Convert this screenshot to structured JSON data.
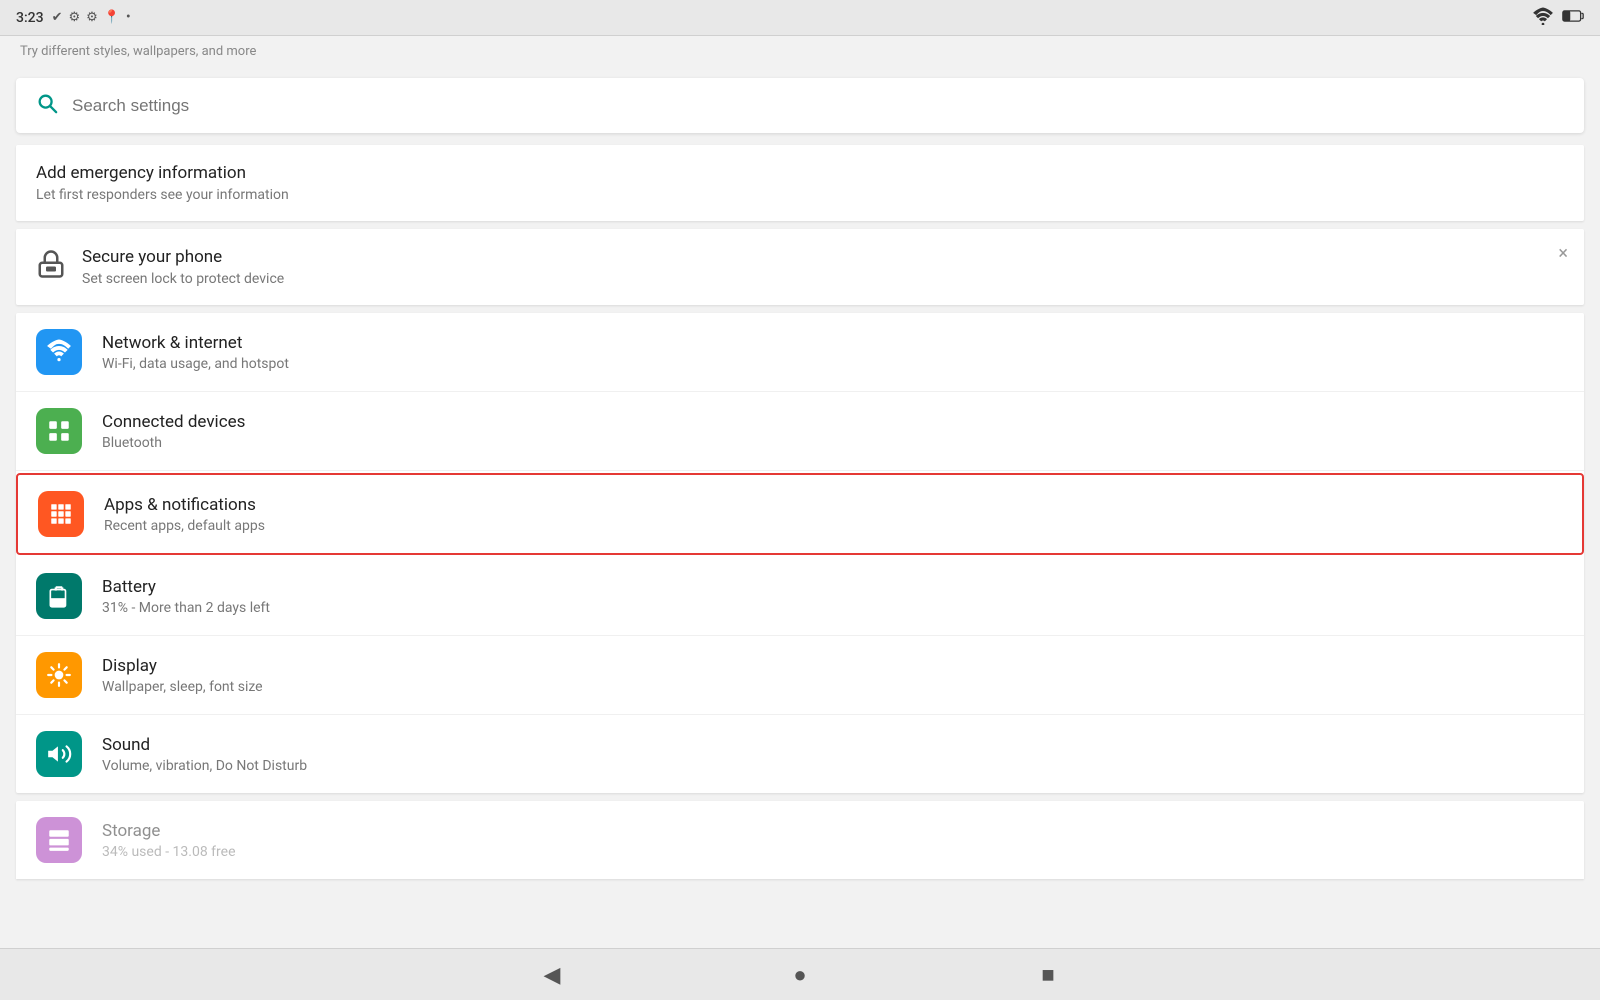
{
  "statusBar": {
    "time": "3:23",
    "wifiIcon": "wifi-icon",
    "batteryIcon": "battery-icon"
  },
  "topPartial": {
    "text": "Try different styles, wallpapers, and more"
  },
  "search": {
    "placeholder": "Search settings"
  },
  "emergencyCard": {
    "title": "Add emergency information",
    "subtitle": "Let first responders see your information"
  },
  "secureCard": {
    "title": "Secure your phone",
    "subtitle": "Set screen lock to protect device",
    "closeLabel": "×"
  },
  "settingsItems": [
    {
      "id": "network",
      "iconColor": "blue",
      "title": "Network & internet",
      "subtitle": "Wi-Fi, data usage, and hotspot",
      "highlighted": false
    },
    {
      "id": "connected",
      "iconColor": "green",
      "title": "Connected devices",
      "subtitle": "Bluetooth",
      "highlighted": false
    },
    {
      "id": "apps",
      "iconColor": "orange",
      "title": "Apps & notifications",
      "subtitle": "Recent apps, default apps",
      "highlighted": true
    },
    {
      "id": "battery",
      "iconColor": "teal-dark",
      "title": "Battery",
      "subtitle": "31% - More than 2 days left",
      "highlighted": false
    },
    {
      "id": "display",
      "iconColor": "amber",
      "title": "Display",
      "subtitle": "Wallpaper, sleep, font size",
      "highlighted": false
    },
    {
      "id": "sound",
      "iconColor": "teal",
      "title": "Sound",
      "subtitle": "Volume, vibration, Do Not Disturb",
      "highlighted": false
    }
  ],
  "storagePartial": {
    "title": "Storage",
    "subtitle": "34% used - 13.08 free"
  },
  "bottomNav": {
    "backLabel": "◀",
    "homeLabel": "●",
    "recentLabel": "■"
  }
}
